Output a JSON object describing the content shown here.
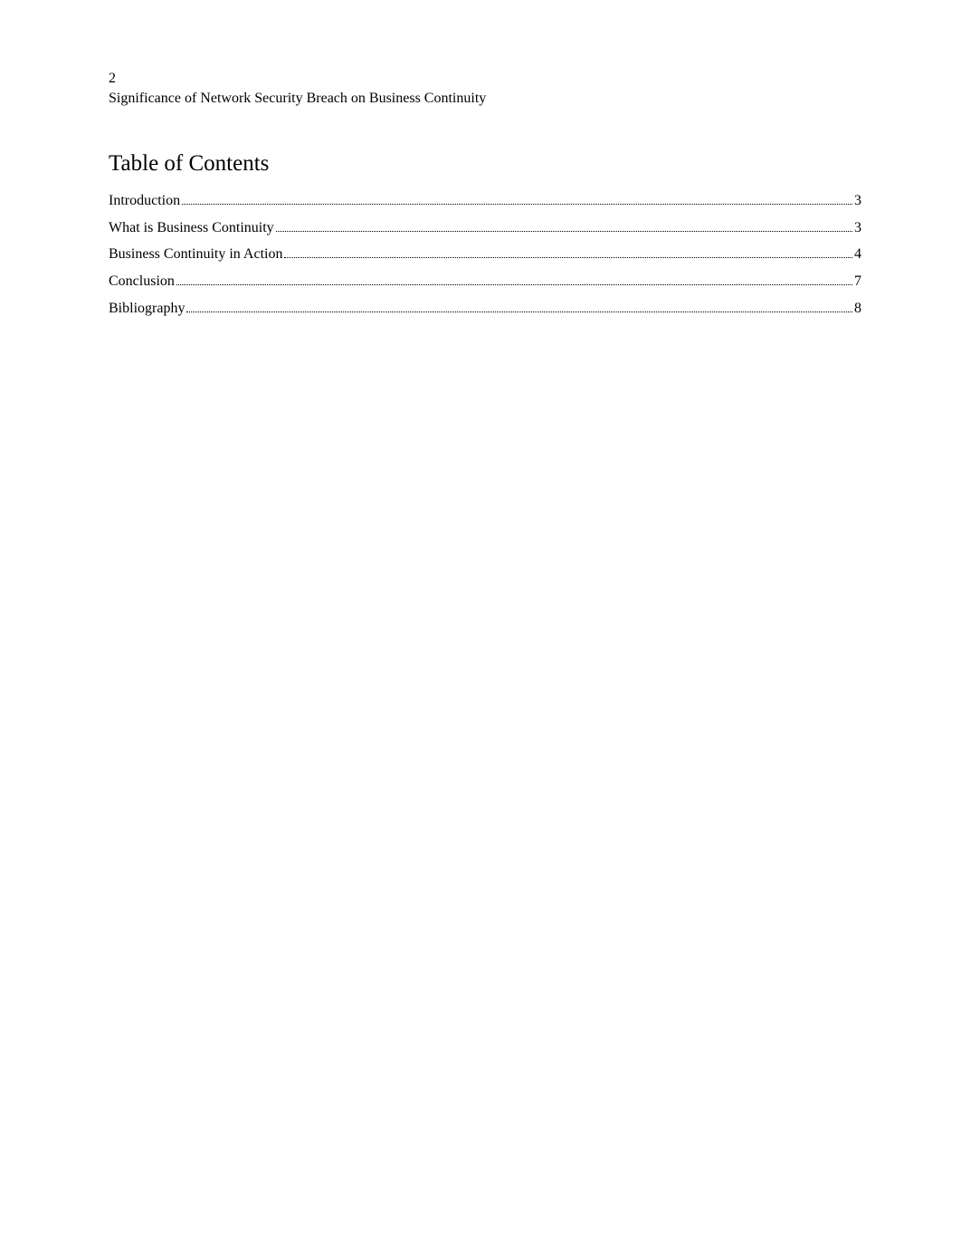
{
  "header": {
    "page_number": "2",
    "running_title": "Significance of Network Security Breach on Business Continuity"
  },
  "toc": {
    "heading": "Table of Contents",
    "entries": [
      {
        "title": "Introduction",
        "page": "3"
      },
      {
        "title": "What is Business Continuity",
        "page": "3"
      },
      {
        "title": "Business Continuity in Action",
        "page": "4"
      },
      {
        "title": "Conclusion",
        "page": "7"
      },
      {
        "title": "Bibliography",
        "page": "8"
      }
    ]
  }
}
